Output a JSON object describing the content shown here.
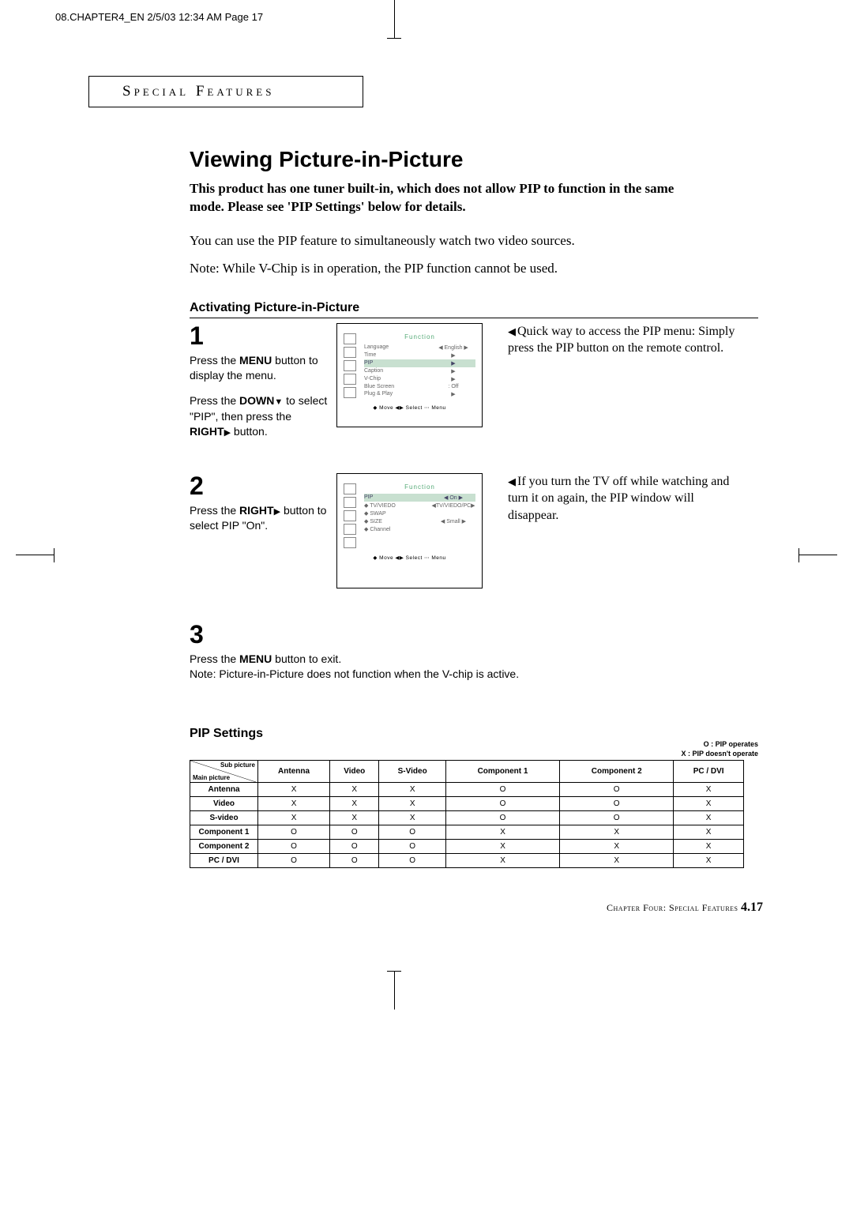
{
  "header": "08.CHAPTER4_EN  2/5/03 12:34 AM  Page 17",
  "sectionLabel": "Special Features",
  "title": "Viewing Picture-in-Picture",
  "intro": "This product has one tuner built-in, which does not allow PIP to function in the same mode. Please see 'PIP Settings' below for details.",
  "body1": "You can use the PIP feature to simultaneously watch two video sources.",
  "body2": "Note:  While V-Chip is in operation, the PIP function cannot be used.",
  "subhead1": "Activating Picture-in-Picture",
  "step1": {
    "num": "1",
    "line1a": "Press the ",
    "line1b": "MENU",
    "line1c": " button to display the menu.",
    "line2a": "Press the ",
    "line2b": "DOWN",
    "line2c": " to select \"PIP\", then press the ",
    "line2d": "RIGHT",
    "line2e": " button.",
    "note": "Quick way to access the PIP menu: Simply press the PIP button on the remote control.",
    "menuTitle": "Function",
    "menu": [
      {
        "l": "Language",
        "r": "◀ English ▶"
      },
      {
        "l": "Time",
        "r": "▶"
      },
      {
        "l": "PIP",
        "r": "▶",
        "sel": true
      },
      {
        "l": "Caption",
        "r": "▶"
      },
      {
        "l": "V-Chip",
        "r": "▶"
      },
      {
        "l": "Blue Screen",
        "r": ": Off"
      },
      {
        "l": "Plug & Play",
        "r": "▶"
      }
    ],
    "footer": "◆ Move   ◀▶ Select   ⋯ Menu"
  },
  "step2": {
    "num": "2",
    "line1a": "Press the ",
    "line1b": "RIGHT",
    "line1c": " button to select PIP \"On\".",
    "note": "If you turn the TV off while watching and turn it on again, the PIP window will disappear.",
    "menuTitle": "Function",
    "menu": [
      {
        "l": "PIP",
        "r": "◀   On   ▶",
        "sel": true
      },
      {
        "l": "◆ TV/VIEDO",
        "r": "◀TV/VIEDO/PC▶"
      },
      {
        "l": "◆ SWAP",
        "r": ""
      },
      {
        "l": "◆ SIZE",
        "r": "◀  Small  ▶"
      },
      {
        "l": "◆ Channel",
        "r": ""
      }
    ],
    "footer": "◆ Move   ◀▶ Select   ⋯ Menu"
  },
  "step3": {
    "num": "3",
    "line1a": "Press the ",
    "line1b": "MENU",
    "line1c": " button to exit.",
    "note": "Note: Picture-in-Picture does not function when the V-chip is active."
  },
  "pipTitle": "PIP Settings",
  "legend": {
    "o": "O :  PIP operates",
    "x": "X :  PIP doesn't operate"
  },
  "chart_data": {
    "type": "table",
    "title": "PIP Settings",
    "corner_top": "Sub picture",
    "corner_bottom": "Main picture",
    "columns": [
      "Antenna",
      "Video",
      "S-Video",
      "Component 1",
      "Component 2",
      "PC / DVI"
    ],
    "rows": [
      "Antenna",
      "Video",
      "S-video",
      "Component 1",
      "Component 2",
      "PC / DVI"
    ],
    "values": [
      [
        "X",
        "X",
        "X",
        "O",
        "O",
        "X"
      ],
      [
        "X",
        "X",
        "X",
        "O",
        "O",
        "X"
      ],
      [
        "X",
        "X",
        "X",
        "O",
        "O",
        "X"
      ],
      [
        "O",
        "O",
        "O",
        "X",
        "X",
        "X"
      ],
      [
        "O",
        "O",
        "O",
        "X",
        "X",
        "X"
      ],
      [
        "O",
        "O",
        "O",
        "X",
        "X",
        "X"
      ]
    ]
  },
  "footer": {
    "pre": "Chapter Four: Special Features ",
    "page": "4.17"
  }
}
